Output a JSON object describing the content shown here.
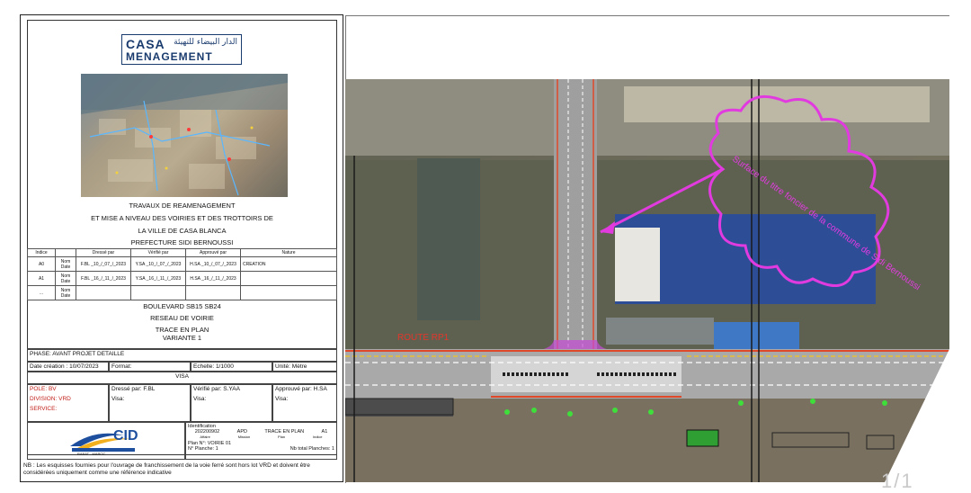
{
  "logo": {
    "brand": "CASA",
    "brand_sub": "MENAGEMENT",
    "arabic": "الدار البيضاء للتهيئة"
  },
  "title_block": {
    "line1": "TRAVAUX DE REAMENAGEMENT",
    "line2": "ET MISE A NIVEAU DES VOIRIES ET DES TROTTOIRS DE",
    "line3": "LA VILLE DE CASA BLANCA",
    "line4": "PREFECTURE SIDI BERNOUSSI"
  },
  "revisions": {
    "headers": [
      "Indice",
      "",
      "Dressé par",
      "Vérifié par",
      "Approuvé par",
      "Nature"
    ],
    "rows": [
      [
        "A0",
        "Nom\nDate",
        "F.BL\n_10_/_07_/_2023",
        "Y.SA\n_10_/_07_/_2023",
        "H.SA\n_10_/_07_/_2023",
        "CREATION"
      ],
      [
        "A1",
        "Nom\nDate",
        "F.BL\n_16_/_11_/_2023",
        "Y.SA\n_16_/_11_/_2023",
        "H.SA\n_16_/_11_/_2023",
        ""
      ],
      [
        "...",
        "Nom\nDate",
        "",
        "",
        "",
        ""
      ]
    ]
  },
  "project": {
    "line1": "BOULEVARD SB15 SB24",
    "line2": "RESEAU DE VOIRIE",
    "line3": "TRACE EN PLAN",
    "line4": "VARIANTE 1"
  },
  "info": {
    "phase": "PHASE: AVANT PROJET DETAILLE",
    "date_creation_label": "Date création :",
    "date_creation": "10/07/2023",
    "format_label": "Format:",
    "echelle_label": "Echelle:",
    "echelle": "1/1000",
    "unite_label": "Unité:",
    "unite": "Mètre",
    "visa": "VISA",
    "pole": "POLE: BV",
    "division": "DIVISION: VRD",
    "service": "SERVICE:",
    "dresse": "Dressé par: F.BL",
    "verifie": "Vérifié par: S.YAA",
    "approuve": "Approuvé par: H.SA",
    "visa_label": "Visa:"
  },
  "identification": {
    "label": "Identification",
    "affaire": "202200902",
    "affaire_label": "Affaire",
    "mission": "APD",
    "mission_label": "Mission",
    "plan": "TRACE EN PLAN",
    "plan_label": "Plan",
    "indice": "A1",
    "indice_label": "Indice",
    "plan_no": "Plan N°: VOIRIE 01",
    "planche_no": "N° Planche: 1",
    "total_planches": "Nb total Planches: 1",
    "cid": "CID",
    "cid_sub": "RABAT - MAROC"
  },
  "note": "NB : Les esquisses fournies pour l'ouvrage de franchissement de la voie ferré sont hors lot VRD et doivent être considérées uniquement comme une référence indicative",
  "map": {
    "cloud_text": "Surface du titre foncier de la commune de Sidi Bernoussi",
    "road_label": "ROUTE RP1"
  },
  "page_counter": "1/1"
}
